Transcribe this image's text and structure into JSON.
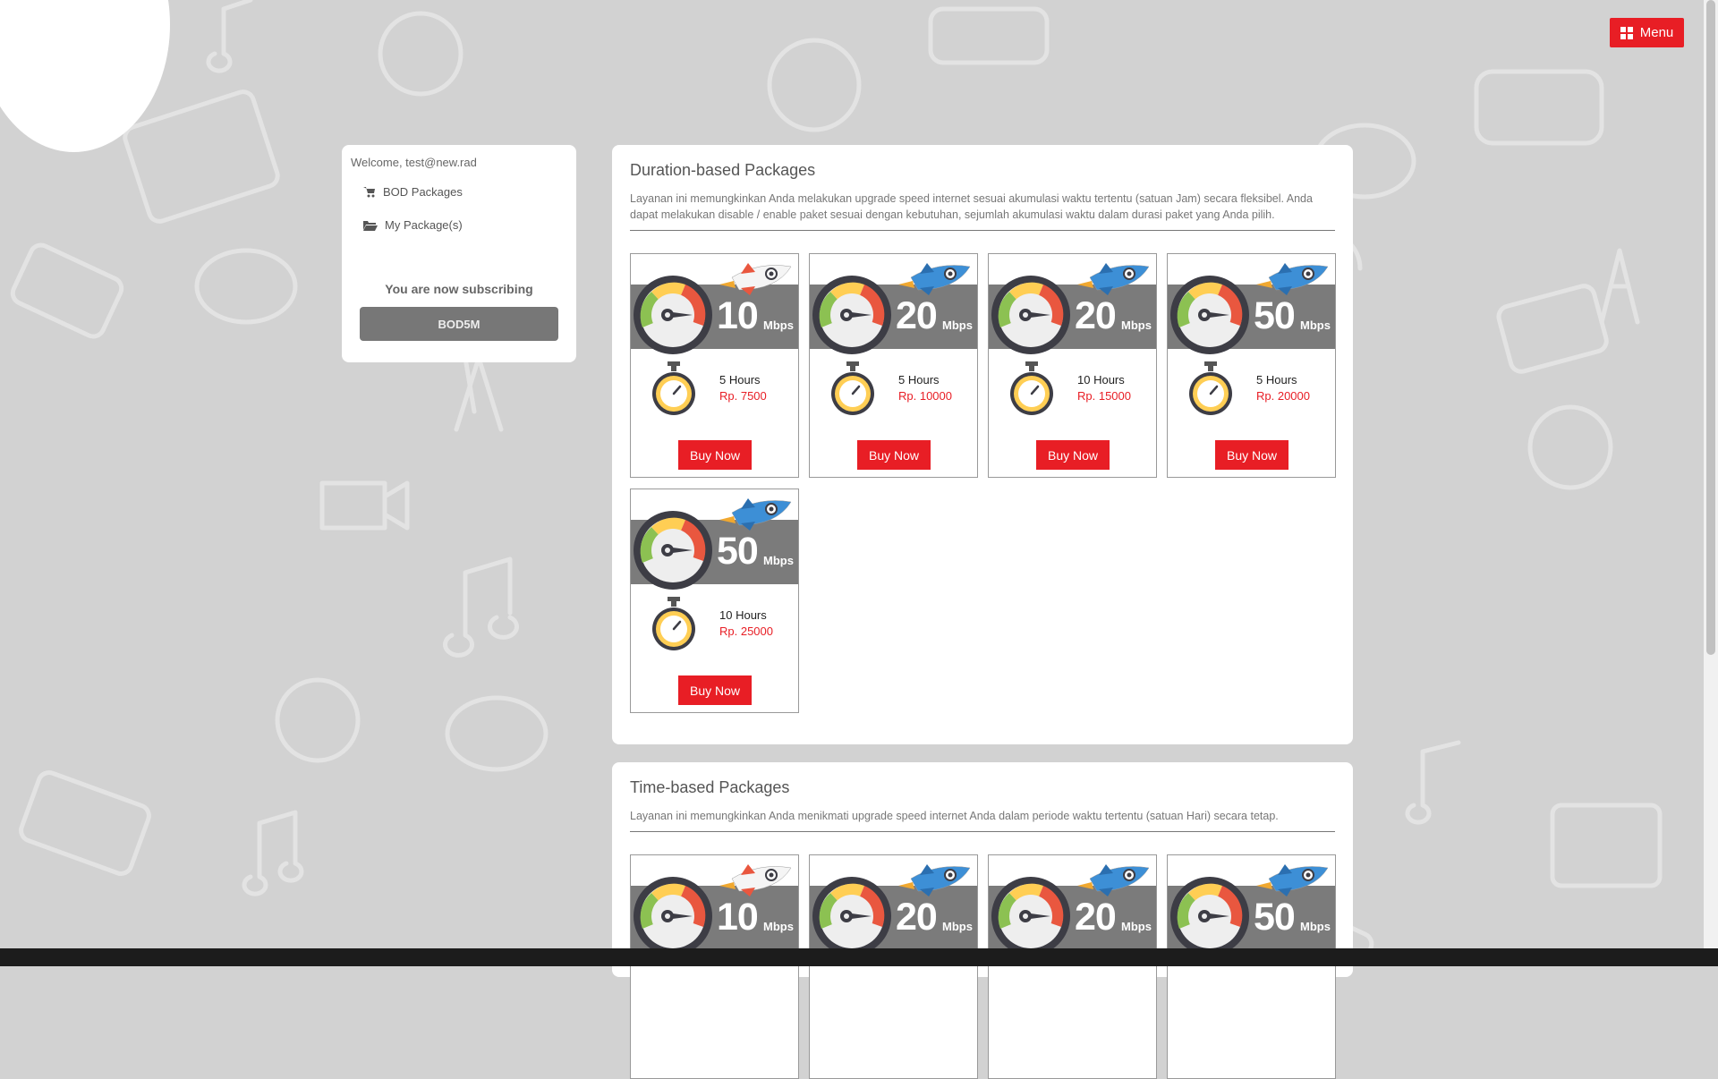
{
  "menu": {
    "label": "Menu",
    "icon": "grid-icon"
  },
  "sidebar": {
    "welcome": "Welcome, test@new.rad",
    "items": [
      {
        "label": "BOD Packages",
        "icon": "cart-icon"
      },
      {
        "label": "My Package(s)",
        "icon": "folder-icon"
      }
    ],
    "subscribing_label": "You are now subscribing",
    "current_package": "BOD5M"
  },
  "duration_section": {
    "title": "Duration-based Packages",
    "description": "Layanan ini memungkinkan Anda melakukan upgrade speed internet sesuai akumulasi waktu tertentu (satuan Jam) secara fleksibel. Anda dapat melakukan disable / enable paket sesuai dengan kebutuhan, sejumlah akumulasi waktu dalam durasi paket yang Anda pilih.",
    "packages": [
      {
        "speed": "10",
        "unit": "Mbps",
        "duration": "5 Hours",
        "price": "Rp. 7500",
        "button": "Buy Now",
        "rocket": "white"
      },
      {
        "speed": "20",
        "unit": "Mbps",
        "duration": "5 Hours",
        "price": "Rp. 10000",
        "button": "Buy Now",
        "rocket": "blue"
      },
      {
        "speed": "20",
        "unit": "Mbps",
        "duration": "10 Hours",
        "price": "Rp. 15000",
        "button": "Buy Now",
        "rocket": "blue"
      },
      {
        "speed": "50",
        "unit": "Mbps",
        "duration": "5 Hours",
        "price": "Rp. 20000",
        "button": "Buy Now",
        "rocket": "blue"
      },
      {
        "speed": "50",
        "unit": "Mbps",
        "duration": "10 Hours",
        "price": "Rp. 25000",
        "button": "Buy Now",
        "rocket": "blue"
      }
    ]
  },
  "time_section": {
    "title": "Time-based Packages",
    "description": "Layanan ini memungkinkan Anda menikmati upgrade speed internet Anda dalam periode waktu tertentu (satuan Hari) secara tetap.",
    "packages": [
      {
        "speed": "10",
        "unit": "Mbps",
        "rocket": "white"
      },
      {
        "speed": "20",
        "unit": "Mbps",
        "rocket": "blue"
      },
      {
        "speed": "20",
        "unit": "Mbps",
        "rocket": "blue"
      },
      {
        "speed": "50",
        "unit": "Mbps",
        "rocket": "blue"
      }
    ]
  },
  "colors": {
    "accent": "#e81e25",
    "banner": "#7b7b7b",
    "background": "#d2d2d2"
  }
}
